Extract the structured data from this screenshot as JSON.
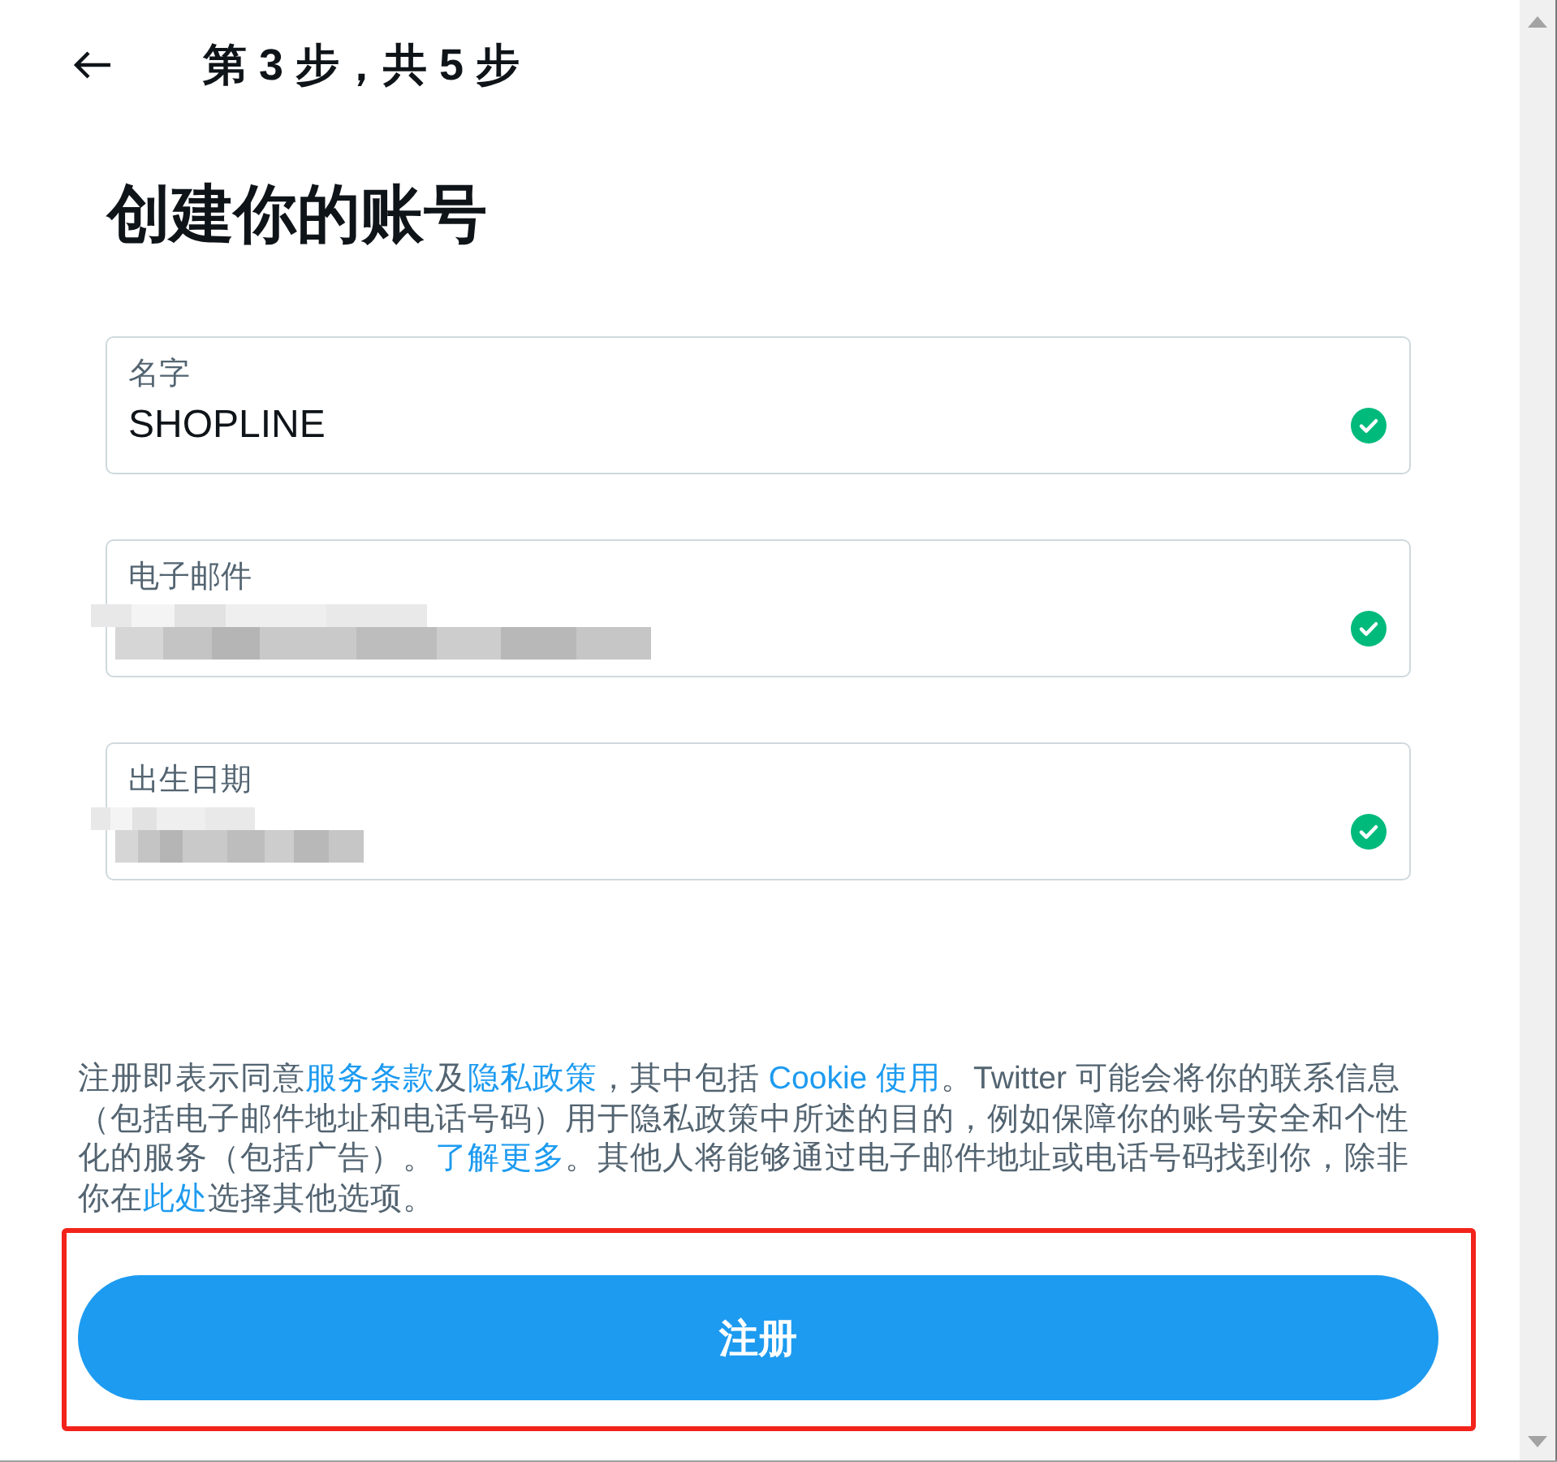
{
  "header": {
    "step": "第 3 步，共 5 步"
  },
  "heading": "创建你的账号",
  "fields": [
    {
      "kind": "text",
      "label": "名字",
      "value": "SHOPLINE",
      "valid": true
    },
    {
      "kind": "email",
      "label": "电子邮件",
      "valid": true
    },
    {
      "kind": "date",
      "label": "出生日期",
      "valid": true
    }
  ],
  "legal": [
    {
      "text": "注册即表示同意",
      "link": false
    },
    {
      "text": "服务条款",
      "link": true
    },
    {
      "text": "及",
      "link": false
    },
    {
      "text": "隐私政策",
      "link": true
    },
    {
      "text": "，其中包括 ",
      "link": false
    },
    {
      "text": "Cookie 使用",
      "link": true
    },
    {
      "text": "。Twitter 可能会将你的联系信息（包括电子邮件地址和电话号码）用于隐私政策中所述的目的，例如保障你的账号安全和个性化的服务（包括广告）。",
      "link": false
    },
    {
      "text": "了解更多",
      "link": true
    },
    {
      "text": "。其他人将能够通过电子邮件地址或电话号码找到你，除非你在",
      "link": false
    },
    {
      "text": "此处",
      "link": true
    },
    {
      "text": "选择其他选项。",
      "link": false
    }
  ],
  "signup_button": {
    "label": "注册",
    "highlighted": true
  }
}
